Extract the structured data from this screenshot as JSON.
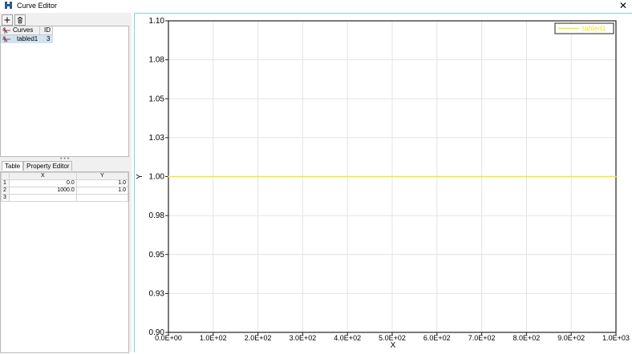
{
  "window": {
    "title": "Curve Editor",
    "close_glyph": "✕",
    "icon": "app-logo-icon"
  },
  "toolbar": {
    "add_glyph": "+",
    "add_icon": "plus-icon",
    "delete_icon": "trash-icon"
  },
  "curves_list": {
    "headers": {
      "name": "Curves",
      "id": "ID"
    },
    "rows": [
      {
        "name": "tabled1",
        "id": "3",
        "selected": true
      }
    ]
  },
  "splitter": "• • •",
  "tabs": [
    {
      "label": "Table",
      "active": true
    },
    {
      "label": "Property Editor",
      "active": false
    }
  ],
  "data_table": {
    "headers": {
      "x": "X",
      "y": "Y"
    },
    "rows": [
      {
        "n": "1",
        "x": "0.0",
        "y": "1.0"
      },
      {
        "n": "2",
        "x": "1000.0",
        "y": "1.0"
      },
      {
        "n": "3",
        "x": "",
        "y": ""
      }
    ]
  },
  "chart_data": {
    "type": "line",
    "xlabel": "X",
    "ylabel": "Y",
    "xlim": [
      0,
      1000
    ],
    "ylim": [
      0.9,
      1.1
    ],
    "x_ticks": [
      "0.0E+00",
      "1.0E+02",
      "2.0E+02",
      "3.0E+02",
      "4.0E+02",
      "5.0E+02",
      "6.0E+02",
      "7.0E+02",
      "8.0E+02",
      "9.0E+02",
      "1.0E+03"
    ],
    "y_ticks": [
      "0.90",
      "0.93",
      "0.95",
      "0.98",
      "1.00",
      "1.03",
      "1.05",
      "1.08",
      "1.10"
    ],
    "grid": true,
    "legend_position": "top-right",
    "series": [
      {
        "name": "tabled1",
        "color": "#f0e82a",
        "x": [
          0,
          1000
        ],
        "y": [
          1.0,
          1.0
        ]
      }
    ]
  }
}
